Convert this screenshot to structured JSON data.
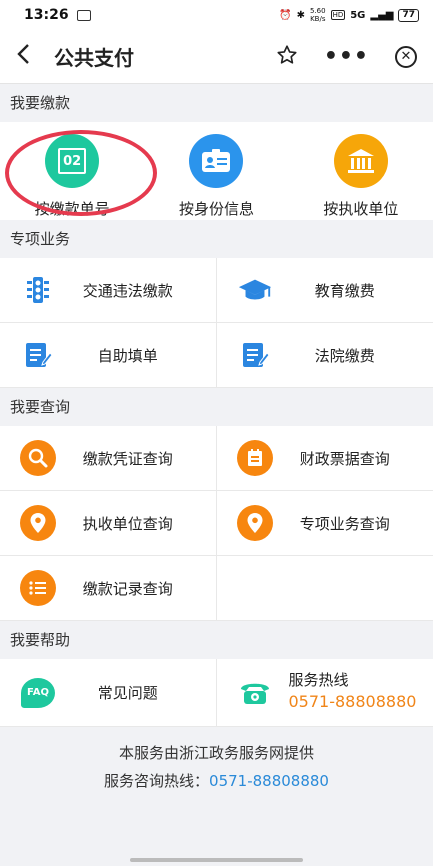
{
  "status_bar": {
    "time": "13:26",
    "net_speed_top": "5.60",
    "net_speed_unit": "KB/s",
    "network": "5G",
    "battery": "77"
  },
  "nav": {
    "title": "公共支付",
    "back_icon": "back-arrow-icon",
    "favorite_icon": "star-icon",
    "more_icon": "more-icon",
    "close_icon": "close-icon"
  },
  "pay": {
    "section_label": "我要缴款",
    "items": [
      {
        "label": "按缴款单号",
        "icon": "payment-number-icon",
        "badge_text": "02",
        "color": "#1ec89e"
      },
      {
        "label": "按身份信息",
        "icon": "id-card-icon",
        "color": "#2b94ec"
      },
      {
        "label": "按执收单位",
        "icon": "bank-building-icon",
        "color": "#f6a609"
      }
    ]
  },
  "special": {
    "section_label": "专项业务",
    "items": [
      {
        "label": "交通违法缴款",
        "icon": "traffic-light-icon"
      },
      {
        "label": "教育缴费",
        "icon": "graduation-cap-icon"
      },
      {
        "label": "自助填单",
        "icon": "form-edit-icon"
      },
      {
        "label": "法院缴费",
        "icon": "court-form-icon"
      }
    ]
  },
  "query": {
    "section_label": "我要查询",
    "items": [
      {
        "label": "缴款凭证查询",
        "icon": "search-icon"
      },
      {
        "label": "财政票据查询",
        "icon": "receipt-icon"
      },
      {
        "label": "执收单位查询",
        "icon": "location-pin-icon"
      },
      {
        "label": "专项业务查询",
        "icon": "location-pin-icon"
      },
      {
        "label": "缴款记录查询",
        "icon": "list-icon"
      }
    ]
  },
  "help": {
    "section_label": "我要帮助",
    "faq_label": "常见问题",
    "faq_icon_text": "FAQ",
    "hotline_label": "服务热线",
    "hotline_number": "0571-88808880",
    "colors": {
      "faq": "#1ec89e",
      "phone": "#1ec89e",
      "number": "#f08519"
    }
  },
  "footer": {
    "provider": "本服务由浙江政务服务网提供",
    "consult_label": "服务咨询热线：",
    "consult_number": "0571-88808880"
  }
}
